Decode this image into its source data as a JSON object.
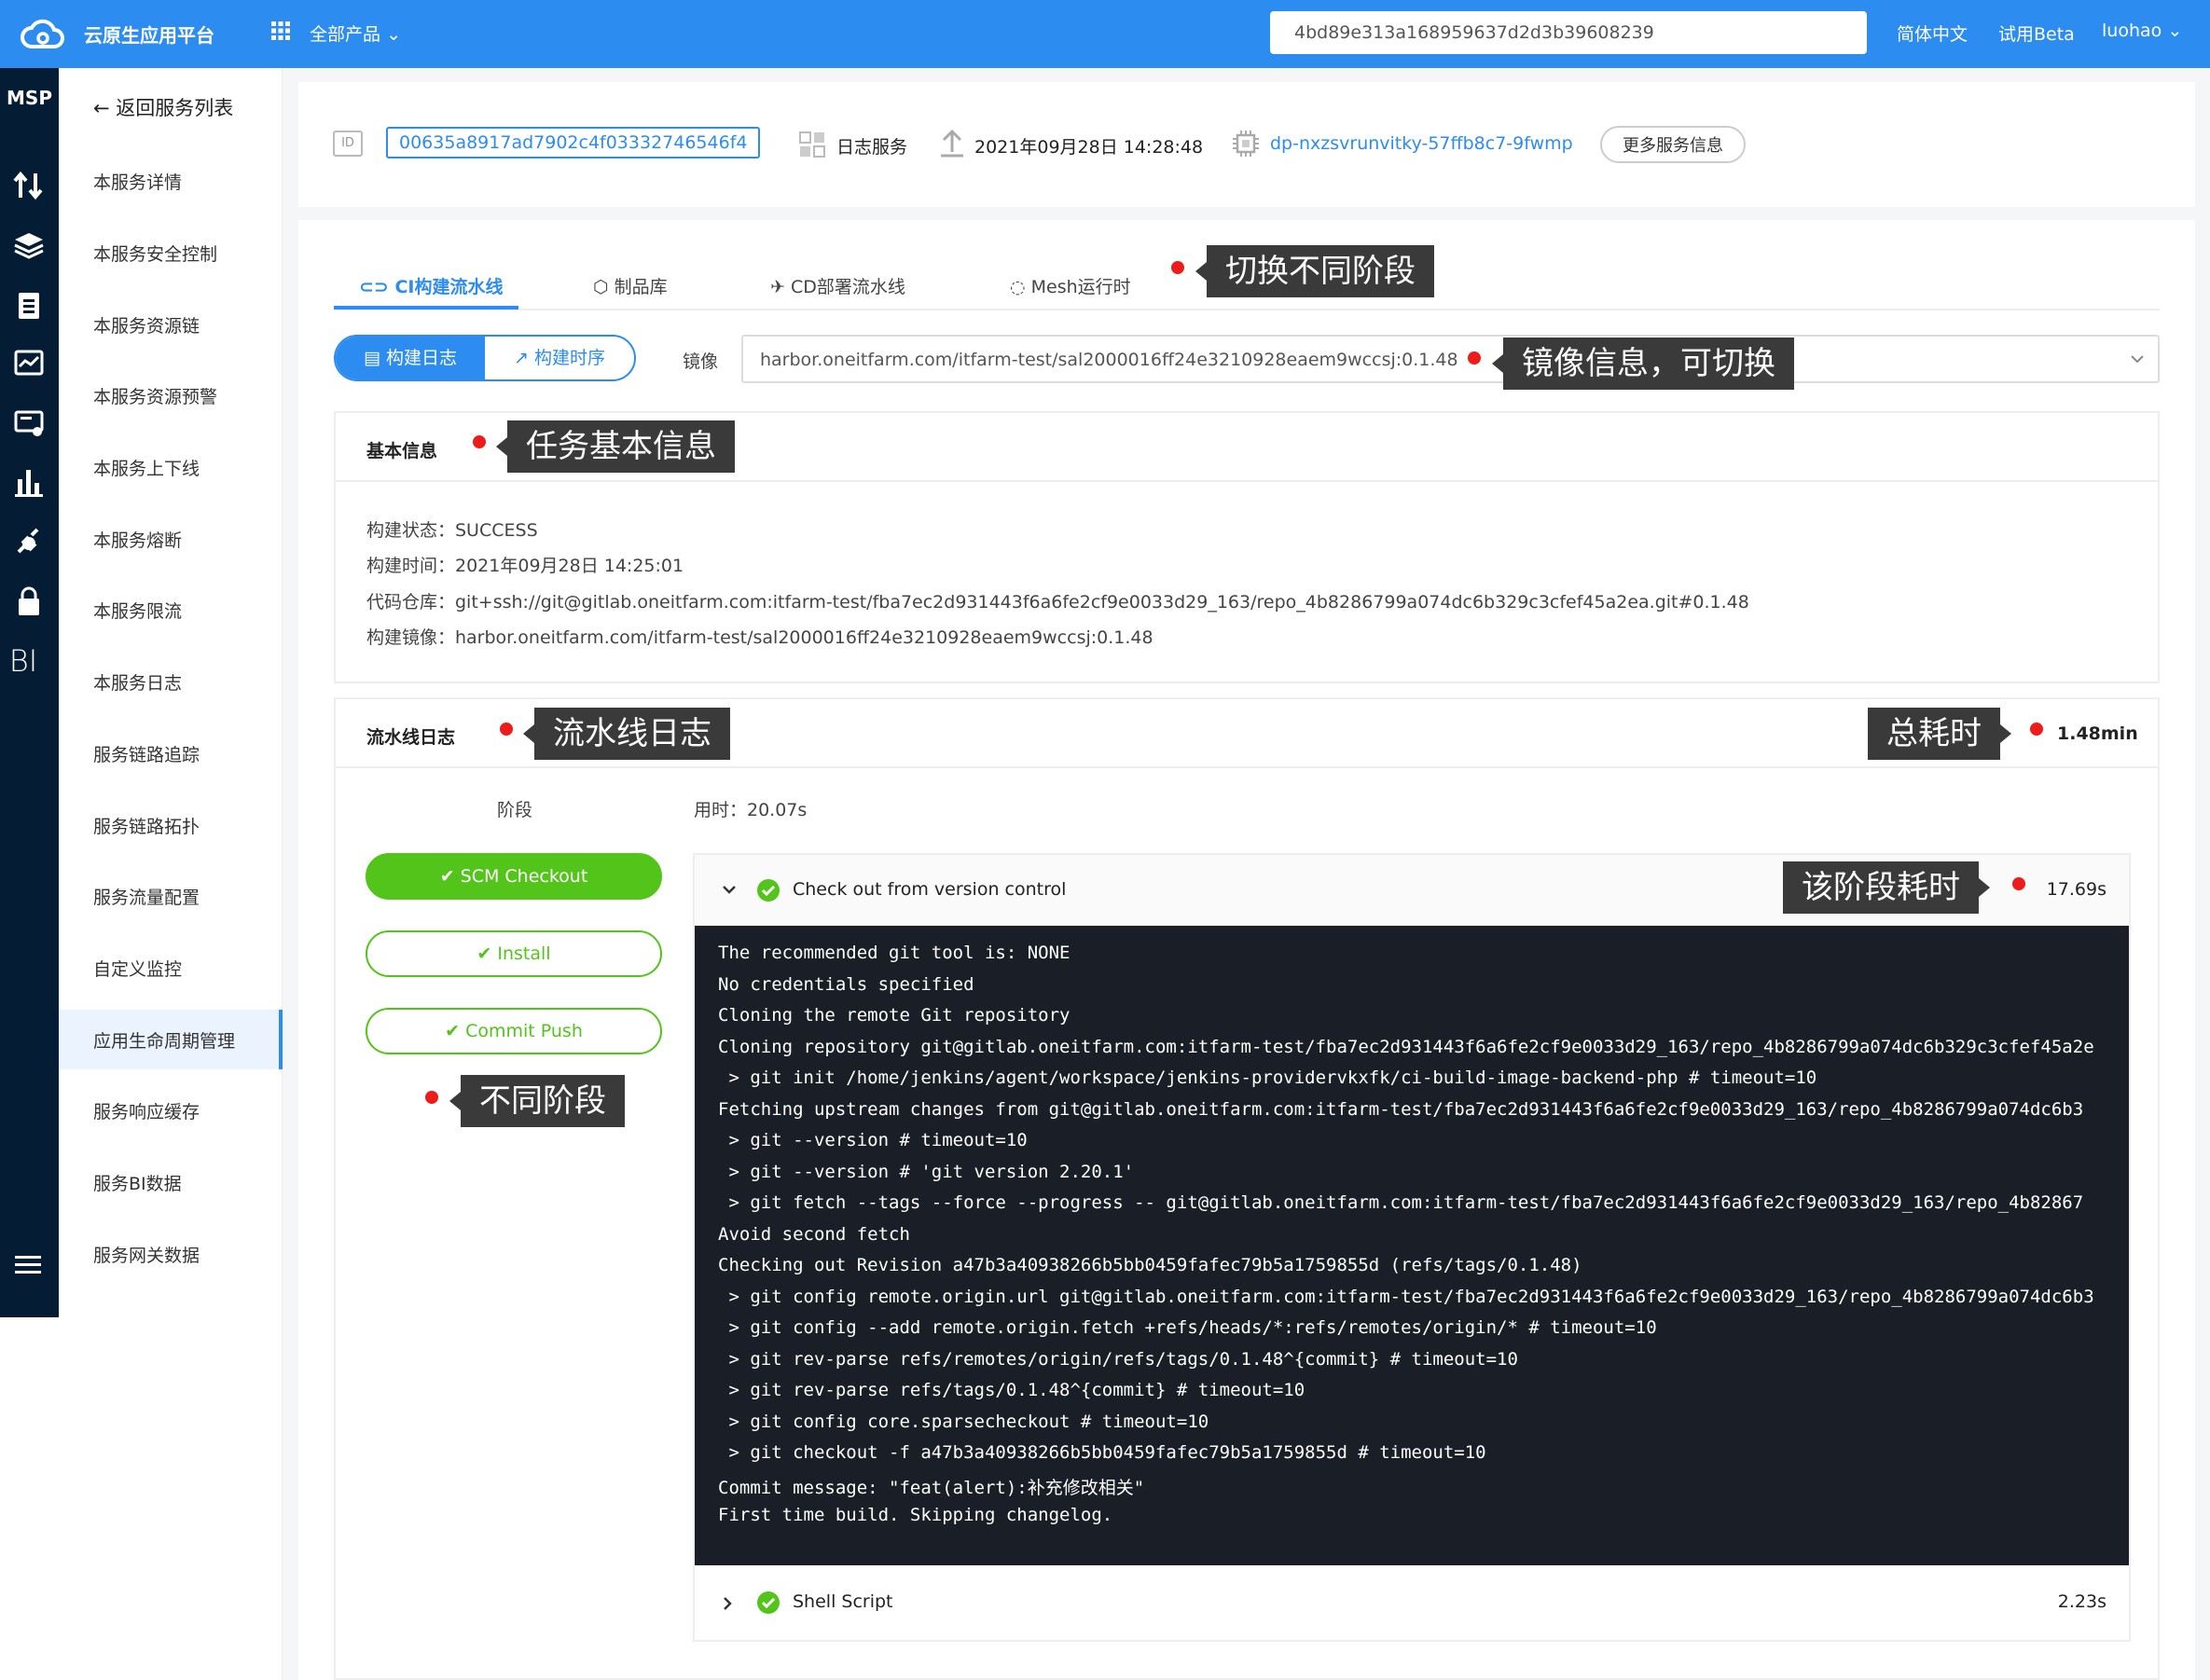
{
  "topbar": {
    "brand": "云原生应用平台",
    "products": "全部产品",
    "search_value": "4bd89e313a168959637d2d3b39608239",
    "lang": "简体中文",
    "beta": "试用Beta",
    "user": "luohao"
  },
  "iconbar": {
    "title": "MSP",
    "bi": "BI"
  },
  "sidebar": {
    "back": "返回服务列表",
    "items": [
      "本服务详情",
      "本服务安全控制",
      "本服务资源链",
      "本服务资源预警",
      "本服务上下线",
      "本服务熔断",
      "本服务限流",
      "本服务日志",
      "服务链路追踪",
      "服务链路拓扑",
      "服务流量配置",
      "自定义监控",
      "应用生命周期管理",
      "服务响应缓存",
      "服务BI数据",
      "服务网关数据"
    ],
    "active_index": 12
  },
  "header": {
    "id_tag": "ID",
    "id": "00635a8917ad7902c4f03332746546f4",
    "service": "日志服务",
    "time": "2021年09月28日 14:28:48",
    "deploy": "dp-nxzsvrunvitky-57ffb8c7-9fwmp",
    "more": "更多服务信息"
  },
  "tabs": [
    "CI构建流水线",
    "制品库",
    "CD部署流水线",
    "Mesh运行时"
  ],
  "segment": {
    "log": "构建日志",
    "seq": "构建时序"
  },
  "mirror": {
    "label": "镜像",
    "value": "harbor.oneitfarm.com/itfarm-test/sal2000016ff24e3210928eaem9wccsj:0.1.48"
  },
  "basic": {
    "title": "基本信息",
    "status": "构建状态：SUCCESS",
    "time": "构建时间：2021年09月28日 14:25:01",
    "repo": "代码仓库：git+ssh://git@gitlab.oneitfarm.com:itfarm-test/fba7ec2d931443f6a6fe2cf9e0033d29_163/repo_4b8286799a074dc6b329c3cfef45a2ea.git#0.1.48",
    "image": "构建镜像：harbor.oneitfarm.com/itfarm-test/sal2000016ff24e3210928eaem9wccsj:0.1.48"
  },
  "pipeline": {
    "title": "流水线日志",
    "total": "1.48min",
    "stage_header": "阶段",
    "time_header": "用时：20.07s",
    "stages": [
      "SCM Checkout",
      "Install",
      "Commit Push"
    ],
    "step1": {
      "title": "Check out from version control",
      "time": "17.69s"
    },
    "step2": {
      "title": "Shell Script",
      "time": "2.23s"
    },
    "log_lines": [
      "The recommended git tool is: NONE",
      "No credentials specified",
      "Cloning the remote Git repository",
      "Cloning repository git@gitlab.oneitfarm.com:itfarm-test/fba7ec2d931443f6a6fe2cf9e0033d29_163/repo_4b8286799a074dc6b329c3cfef45a2e",
      " > git init /home/jenkins/agent/workspace/jenkins-providervkxfk/ci-build-image-backend-php # timeout=10",
      "Fetching upstream changes from git@gitlab.oneitfarm.com:itfarm-test/fba7ec2d931443f6a6fe2cf9e0033d29_163/repo_4b8286799a074dc6b3",
      " > git --version # timeout=10",
      " > git --version # 'git version 2.20.1'",
      " > git fetch --tags --force --progress -- git@gitlab.oneitfarm.com:itfarm-test/fba7ec2d931443f6a6fe2cf9e0033d29_163/repo_4b82867",
      "Avoid second fetch",
      "Checking out Revision a47b3a40938266b5bb0459fafec79b5a1759855d (refs/tags/0.1.48)",
      " > git config remote.origin.url git@gitlab.oneitfarm.com:itfarm-test/fba7ec2d931443f6a6fe2cf9e0033d29_163/repo_4b8286799a074dc6b3",
      " > git config --add remote.origin.fetch +refs/heads/*:refs/remotes/origin/* # timeout=10",
      " > git rev-parse refs/remotes/origin/refs/tags/0.1.48^{commit} # timeout=10",
      " > git rev-parse refs/tags/0.1.48^{commit} # timeout=10",
      " > git config core.sparsecheckout # timeout=10",
      " > git checkout -f a47b3a40938266b5bb0459fafec79b5a1759855d # timeout=10",
      "Commit message: \"feat(alert):补充修改相关\"",
      "First time build. Skipping changelog."
    ]
  },
  "callouts": {
    "stage_switch": "切换不同阶段",
    "mirror": "镜像信息，可切换",
    "basic": "任务基本信息",
    "pipeline": "流水线日志",
    "total": "总耗时",
    "step_time": "该阶段耗时",
    "stages": "不同阶段"
  },
  "colors": {
    "primary": "#2c8cf0",
    "success": "#52c41a",
    "dark": "#051c35",
    "marker": "#ee1b1b"
  }
}
